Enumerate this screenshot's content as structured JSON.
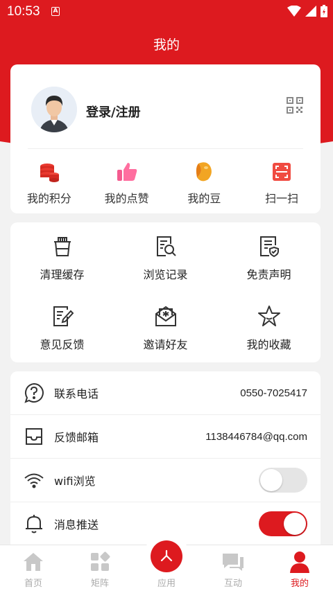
{
  "status": {
    "time": "10:53",
    "notice": "A"
  },
  "header": {
    "title": "我的"
  },
  "profile": {
    "login_label": "登录/注册"
  },
  "quick_actions": [
    {
      "label": "我的积分",
      "icon": "coins-icon"
    },
    {
      "label": "我的点赞",
      "icon": "thumbs-up-icon"
    },
    {
      "label": "我的豆",
      "icon": "bean-icon"
    },
    {
      "label": "扫一扫",
      "icon": "scan-icon"
    }
  ],
  "tools": [
    {
      "label": "清理缓存",
      "icon": "trash-icon"
    },
    {
      "label": "浏览记录",
      "icon": "history-icon"
    },
    {
      "label": "免责声明",
      "icon": "disclaimer-icon"
    },
    {
      "label": "意见反馈",
      "icon": "feedback-icon"
    },
    {
      "label": "邀请好友",
      "icon": "invite-icon"
    },
    {
      "label": "我的收藏",
      "icon": "star-icon"
    }
  ],
  "settings": {
    "phone": {
      "label": "联系电话",
      "value": "0550-7025417"
    },
    "email": {
      "label": "反馈邮箱",
      "value": "1138446784@qq.com"
    },
    "wifi": {
      "label": "wifi浏览",
      "enabled": false
    },
    "push": {
      "label": "消息推送",
      "enabled": true
    }
  },
  "tabs": [
    {
      "label": "首页",
      "active": false
    },
    {
      "label": "矩阵",
      "active": false
    },
    {
      "label": "应用",
      "active": false
    },
    {
      "label": "互动",
      "active": false
    },
    {
      "label": "我的",
      "active": true
    }
  ],
  "colors": {
    "accent": "#dd1a1f",
    "inactive": "#c8c8c8"
  }
}
